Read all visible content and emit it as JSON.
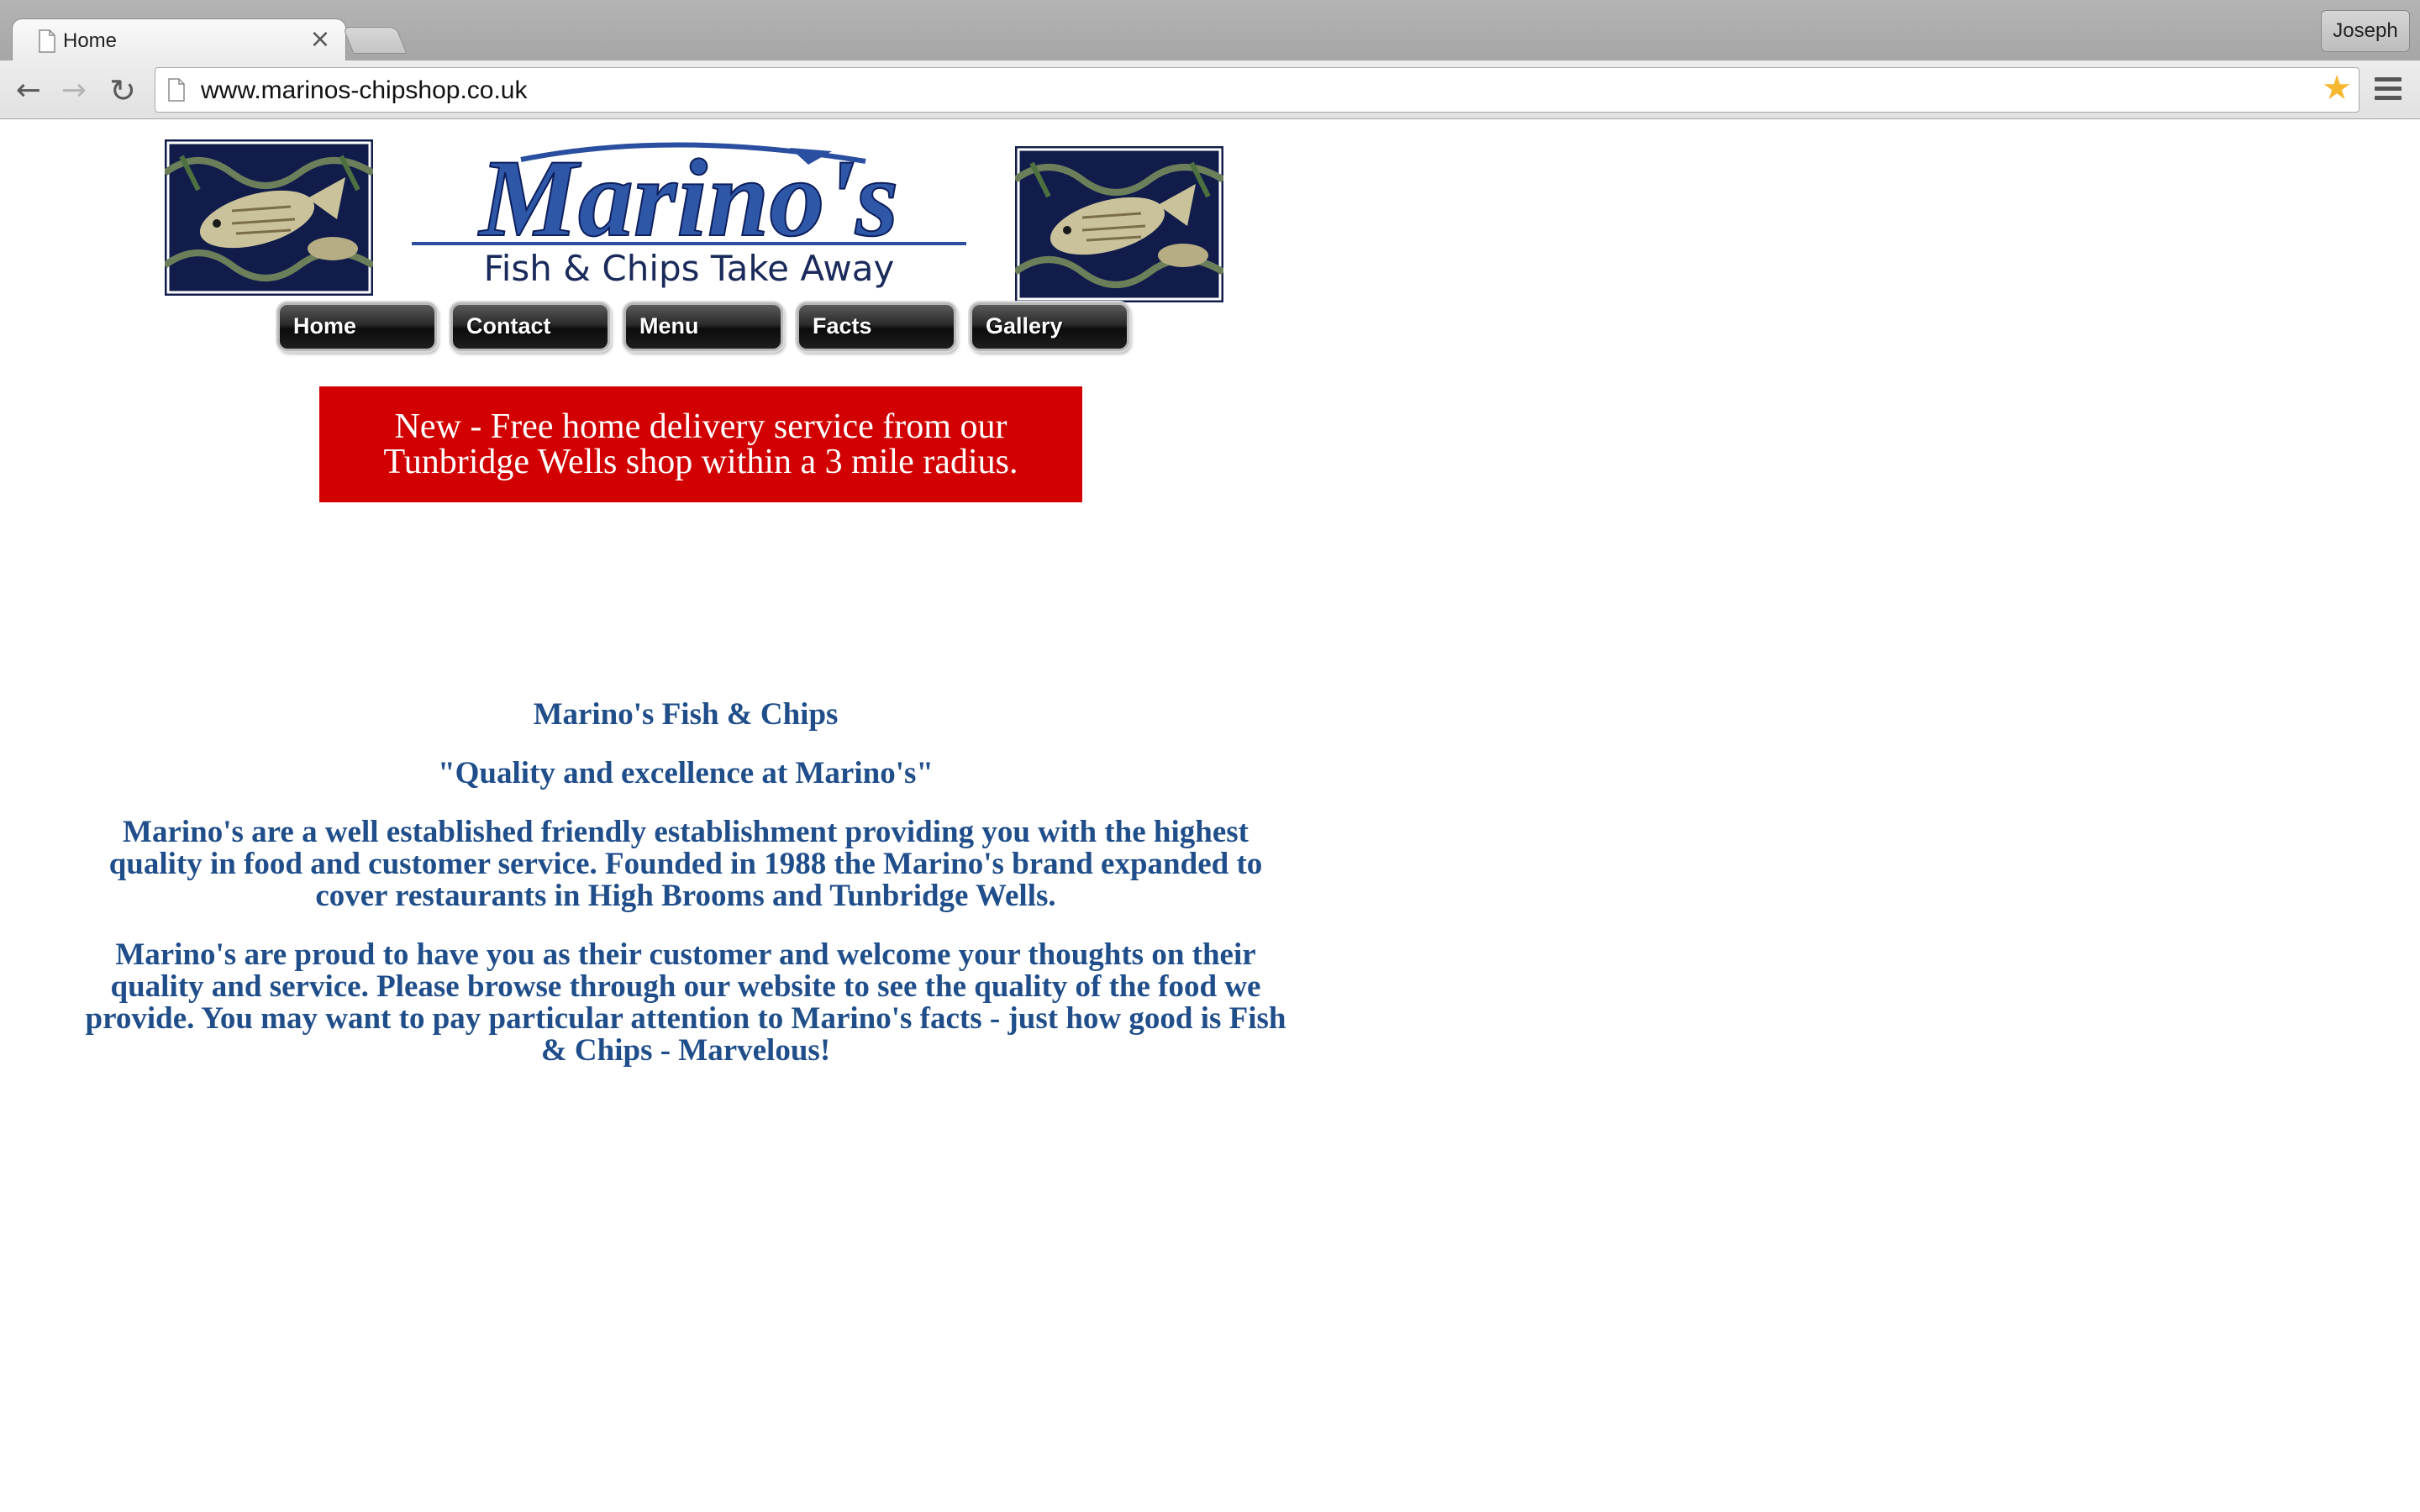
{
  "browser": {
    "tab_title": "Home",
    "tab_close": "×",
    "profile_name": "Joseph",
    "url": "www.marinos-chipshop.co.uk",
    "icons": {
      "back": "back-arrow-icon",
      "forward": "forward-arrow-icon",
      "reload": "reload-icon",
      "bookmark": "star-icon",
      "menu": "menu-icon"
    },
    "colors": {
      "bookmark_star": "#f6b830"
    }
  },
  "header": {
    "logo_title": "Marino's",
    "logo_subtitle": "Fish & Chips Take Away"
  },
  "nav": {
    "items": [
      {
        "label": "Home"
      },
      {
        "label": "Contact"
      },
      {
        "label": "Menu"
      },
      {
        "label": "Facts"
      },
      {
        "label": "Gallery"
      }
    ]
  },
  "banner": {
    "text": "New - Free home delivery service from our Tunbridge Wells shop within a 3 mile radius.",
    "background": "#d20000"
  },
  "content": {
    "heading": "Marino's Fish & Chips",
    "tagline": "\"Quality and excellence at Marino's\"",
    "paragraph1": "Marino's are a well established friendly establishment providing you with the highest quality in food and customer service.  Founded in 1988 the Marino's brand expanded to cover restaurants in High Brooms and Tunbridge Wells.",
    "paragraph2": "Marino's are proud to have you as their customer and welcome your thoughts on their quality and service.  Please browse through our website to see the quality of the food we provide.  You may want to pay particular attention to Marino's facts - just how good is Fish & Chips - Marvelous!",
    "text_color": "#1f4e8a"
  }
}
